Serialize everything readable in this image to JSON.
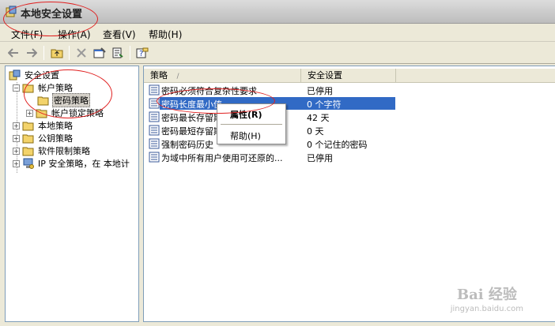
{
  "window": {
    "title": "本地安全设置"
  },
  "menu": [
    "文件(F)",
    "操作(A)",
    "查看(V)",
    "帮助(H)"
  ],
  "tree": {
    "root": "安全设置",
    "items": [
      {
        "label": "帐户策略",
        "level": 1
      },
      {
        "label": "密码策略",
        "level": 2
      },
      {
        "label": "帐户锁定策略",
        "level": 2
      },
      {
        "label": "本地策略",
        "level": 1
      },
      {
        "label": "公钥策略",
        "level": 1
      },
      {
        "label": "软件限制策略",
        "level": 1
      },
      {
        "label": "IP 安全策略，在 本地计",
        "level": 1
      }
    ]
  },
  "list": {
    "columns": [
      "策略",
      "安全设置"
    ],
    "rows": [
      {
        "policy": "密码必须符合复杂性要求",
        "setting": "已停用"
      },
      {
        "policy": "密码长度最小值",
        "setting": "0 个字符"
      },
      {
        "policy": "密码最长存留期",
        "setting": "42 天"
      },
      {
        "policy": "密码最短存留期",
        "setting": "0 天"
      },
      {
        "policy": "强制密码历史",
        "setting": "0 个记住的密码"
      },
      {
        "policy": "为域中所有用户使用可还原的...",
        "setting": "已停用"
      }
    ]
  },
  "context_menu": {
    "properties": "属性(R)",
    "help": "帮助(H)"
  },
  "watermark": {
    "main": "Bai 经验",
    "sub": "jingyan.baidu.com"
  },
  "colors": {
    "selection": "#316ac5",
    "annotation": "#e02020"
  }
}
